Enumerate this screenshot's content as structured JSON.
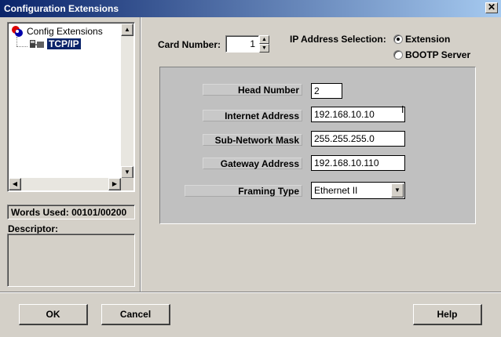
{
  "window": {
    "title": "Configuration Extensions",
    "close_glyph": "✕"
  },
  "tree": {
    "root_label": "Config Extensions",
    "root_icon": "config-extensions-icon",
    "child_label": "TCP/IP",
    "child_icon": "tcpip-module-icon"
  },
  "status": {
    "words_used": "Words Used: 00101/00200"
  },
  "descriptor": {
    "label": "Descriptor:",
    "value": ""
  },
  "card": {
    "label": "Card Number:",
    "value": "1"
  },
  "ip_selection": {
    "label": "IP Address Selection:",
    "options": [
      {
        "label": "Extension",
        "selected": true
      },
      {
        "label": "BOOTP Server",
        "selected": false
      }
    ]
  },
  "fields": {
    "head_number": {
      "label": "Head Number",
      "value": "2"
    },
    "internet_address": {
      "label": "Internet Address",
      "value": "192.168.10.10"
    },
    "subnet_mask": {
      "label": "Sub-Network Mask",
      "value": "255.255.255.0"
    },
    "gateway": {
      "label": "Gateway Address",
      "value": "192.168.10.110"
    },
    "framing": {
      "label": "Framing Type",
      "value": "Ethernet II"
    }
  },
  "buttons": {
    "ok": "OK",
    "cancel": "Cancel",
    "help": "Help"
  },
  "colors": {
    "face": "#d4d0c8",
    "title_start": "#0a246a",
    "title_end": "#a6caf0",
    "panel": "#c0c0c0",
    "selection": "#0a246a"
  }
}
